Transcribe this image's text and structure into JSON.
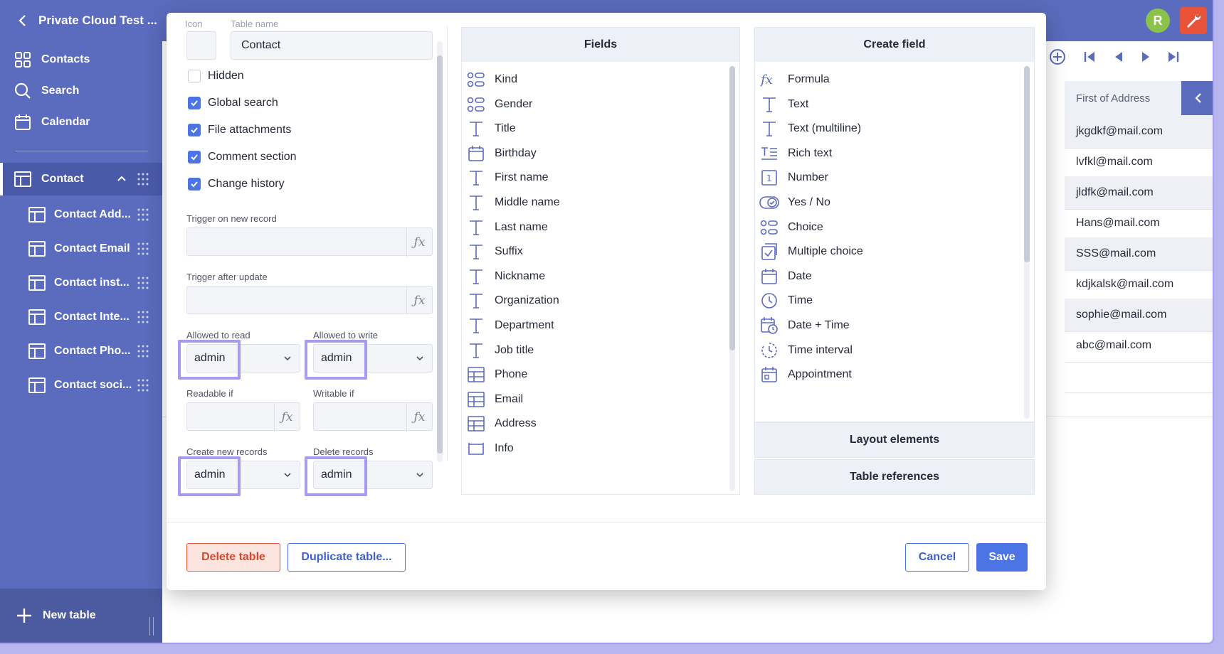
{
  "app": {
    "title": "Private Cloud Test ..."
  },
  "nav": [
    {
      "label": "Contacts",
      "icon": "grid-icon"
    },
    {
      "label": "Search",
      "icon": "search-icon"
    },
    {
      "label": "Calendar",
      "icon": "calendar-icon"
    }
  ],
  "tables": [
    {
      "label": "Contact",
      "active": true
    },
    {
      "label": "Contact Add..."
    },
    {
      "label": "Contact Email"
    },
    {
      "label": "Contact inst..."
    },
    {
      "label": "Contact Inte..."
    },
    {
      "label": "Contact Pho..."
    },
    {
      "label": "Contact soci..."
    }
  ],
  "new_table": "New table",
  "user": {
    "avatar_letter": "R"
  },
  "background": {
    "column_header": "First of Address",
    "cells": [
      "jkgdkf@mail.com",
      "lvfkl@mail.com",
      "jldfk@mail.com",
      "Hans@mail.com",
      "SSS@mail.com",
      "kdjkalsk@mail.com",
      "sophie@mail.com",
      "abc@mail.com"
    ]
  },
  "modal": {
    "icon_label": "Icon",
    "table_name_label": "Table name",
    "table_name_value": "Contact",
    "checkboxes": [
      {
        "label": "Hidden",
        "checked": false
      },
      {
        "label": "Global search",
        "checked": true
      },
      {
        "label": "File attachments",
        "checked": true
      },
      {
        "label": "Comment section",
        "checked": true
      },
      {
        "label": "Change history",
        "checked": true
      }
    ],
    "trigger_new_label": "Trigger on new record",
    "trigger_update_label": "Trigger after update",
    "fx_symbol": "ƒx",
    "allowed_read_label": "Allowed to read",
    "allowed_read_value": "admin",
    "allowed_write_label": "Allowed to write",
    "allowed_write_value": "admin",
    "readable_if_label": "Readable if",
    "writable_if_label": "Writable if",
    "create_records_label": "Create new records",
    "create_records_value": "admin",
    "delete_records_label": "Delete records",
    "delete_records_value": "admin",
    "fields_title": "Fields",
    "fields": [
      {
        "label": "Kind",
        "icon": "choice-icon"
      },
      {
        "label": "Gender",
        "icon": "choice-icon"
      },
      {
        "label": "Title",
        "icon": "text-icon"
      },
      {
        "label": "Birthday",
        "icon": "calendar-icon"
      },
      {
        "label": "First name",
        "icon": "text-icon"
      },
      {
        "label": "Middle name",
        "icon": "text-icon"
      },
      {
        "label": "Last name",
        "icon": "text-icon"
      },
      {
        "label": "Suffix",
        "icon": "text-icon"
      },
      {
        "label": "Nickname",
        "icon": "text-icon"
      },
      {
        "label": "Organization",
        "icon": "text-icon"
      },
      {
        "label": "Department",
        "icon": "text-icon"
      },
      {
        "label": "Job title",
        "icon": "text-icon"
      },
      {
        "label": "Phone",
        "icon": "table-icon"
      },
      {
        "label": "Email",
        "icon": "table-icon"
      },
      {
        "label": "Address",
        "icon": "table-icon"
      },
      {
        "label": "Info",
        "icon": "box-icon"
      }
    ],
    "create_title": "Create field",
    "create_fields": [
      {
        "label": "Formula",
        "icon": "formula-icon"
      },
      {
        "label": "Text",
        "icon": "text-icon"
      },
      {
        "label": "Text (multiline)",
        "icon": "text-icon"
      },
      {
        "label": "Rich text",
        "icon": "richtext-icon"
      },
      {
        "label": "Number",
        "icon": "number-icon"
      },
      {
        "label": "Yes / No",
        "icon": "toggle-icon"
      },
      {
        "label": "Choice",
        "icon": "choice-icon"
      },
      {
        "label": "Multiple choice",
        "icon": "multichoice-icon"
      },
      {
        "label": "Date",
        "icon": "calendar-icon"
      },
      {
        "label": "Time",
        "icon": "clock-icon"
      },
      {
        "label": "Date + Time",
        "icon": "datetime-icon"
      },
      {
        "label": "Time interval",
        "icon": "interval-icon"
      },
      {
        "label": "Appointment",
        "icon": "appointment-icon"
      }
    ],
    "layout_elements": "Layout elements",
    "table_references": "Table references",
    "delete_btn": "Delete table",
    "duplicate_btn": "Duplicate table...",
    "cancel_btn": "Cancel",
    "save_btn": "Save"
  },
  "colors": {
    "accent": "#4d74e4",
    "sidebar": "#5b6bbd",
    "danger": "#e8533a",
    "highlight": "#a59cef"
  }
}
